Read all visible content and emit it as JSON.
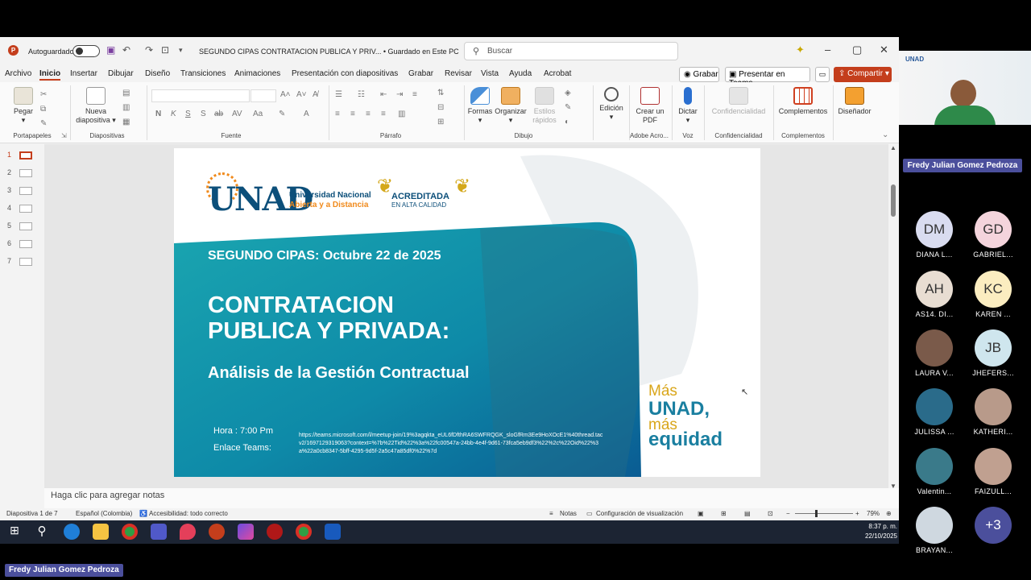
{
  "titlebar": {
    "autosave_label": "Autoguardado",
    "doc_title": "SEGUNDO CIPAS CONTRATACION PUBLICA Y PRIV...  •  Guardado en Este PC",
    "search_placeholder": "Buscar"
  },
  "menu": [
    "Archivo",
    "Inicio",
    "Insertar",
    "Dibujar",
    "Diseño",
    "Transiciones",
    "Animaciones",
    "Presentación con diapositivas",
    "Grabar",
    "Revisar",
    "Vista",
    "Ayuda",
    "Acrobat"
  ],
  "menu_active": "Inicio",
  "actions": {
    "grabar": "Grabar",
    "teams": "Presentar en Teams",
    "share": "Compartir"
  },
  "ribbon": {
    "pegar": "Pegar",
    "nueva": "Nueva diapositiva",
    "formas": "Formas",
    "organizar": "Organizar",
    "estilos": "Estilos rápidos",
    "edicion": "Edición",
    "crear_pdf": "Crear un PDF",
    "dictar": "Dictar",
    "confidencialidad": "Confidencialidad",
    "complementos": "Complementos",
    "disenador": "Diseñador",
    "groups": {
      "portapapeles": "Portapapeles",
      "diapositivas": "Diapositivas",
      "fuente": "Fuente",
      "parrafo": "Párrafo",
      "dibujo": "Dibujo",
      "adobe": "Adobe Acro...",
      "voz": "Voz",
      "confidencialidad": "Confidencialidad",
      "complementos": "Complementos"
    }
  },
  "thumbnails": [
    "1",
    "2",
    "3",
    "4",
    "5",
    "6",
    "7"
  ],
  "slide": {
    "logo_letters": "UNAD",
    "uni_line1": "Universidad Nacional",
    "uni_line2": "Abierta y a Distancia",
    "acreditada1": "ACREDITADA",
    "acreditada2": "EN ALTA CALIDAD",
    "subtitle": "SEGUNDO CIPAS: Octubre 22 de 2025",
    "title1": "CONTRATACION",
    "title2": "PUBLICA Y PRIVADA:",
    "title3": "Análisis de la Gestión Contractual",
    "hora": "Hora : 7:00 Pm",
    "enlace": "Enlace Teams:",
    "link": "https://teams.microsoft.com/l/meetup-join/19%3agqkta_eUL6fDfthRA6SWFRQGK_sloGfRm3Ee9HoXOcE1%40thread.tacv2/1697129319063?context=%7b%22Tid%22%3a%22fc00547a-24bb-4e4f-9d61-73fca5eb9df3%22%2c%22Oid%22%3a%22a0cb8347-5bff-4295-9d5f-2a5c47a85df0%22%7d",
    "slogan1": "Más",
    "slogan2": "UNAD,",
    "slogan3": "más",
    "slogan4": "equidad"
  },
  "notes_placeholder": "Haga clic para agregar notas",
  "status": {
    "slide": "Diapositiva 1 de 7",
    "lang": "Español (Colombia)",
    "access": "Accesibilidad: todo correcto",
    "notas": "Notas",
    "config": "Configuración de visualización",
    "zoom": "79%"
  },
  "clock": {
    "time": "8:37 p. m.",
    "date": "22/10/2025"
  },
  "presenter": "Fredy Julian Gomez Pedroza",
  "participants": [
    {
      "initials": "DM",
      "name": "DIANA L...",
      "color": "#d9dcf0"
    },
    {
      "initials": "GD",
      "name": "GABRIEL...",
      "color": "#f4d4dc"
    },
    {
      "initials": "AH",
      "name": "AS14. DI...",
      "color": "#e8ddd2"
    },
    {
      "initials": "KC",
      "name": "KAREN ...",
      "color": "#fbedc0"
    },
    {
      "initials": "",
      "name": "LAURA V...",
      "color": "#7a5a4a"
    },
    {
      "initials": "JB",
      "name": "JHEFERS...",
      "color": "#cfe6ee"
    },
    {
      "initials": "",
      "name": "JULISSA ...",
      "color": "#2a6b8a"
    },
    {
      "initials": "",
      "name": "KATHERI...",
      "color": "#b89a8a"
    },
    {
      "initials": "",
      "name": "Valentin...",
      "color": "#3a7a8a"
    },
    {
      "initials": "",
      "name": "FAIZULL...",
      "color": "#c0a090"
    },
    {
      "initials": "",
      "name": "BRAYAN...",
      "color": "#cfd8e0"
    },
    {
      "initials": "+3",
      "name": "",
      "color": "#4b4f9c"
    }
  ],
  "bottom_name": "Fredy Julian Gomez Pedroza"
}
